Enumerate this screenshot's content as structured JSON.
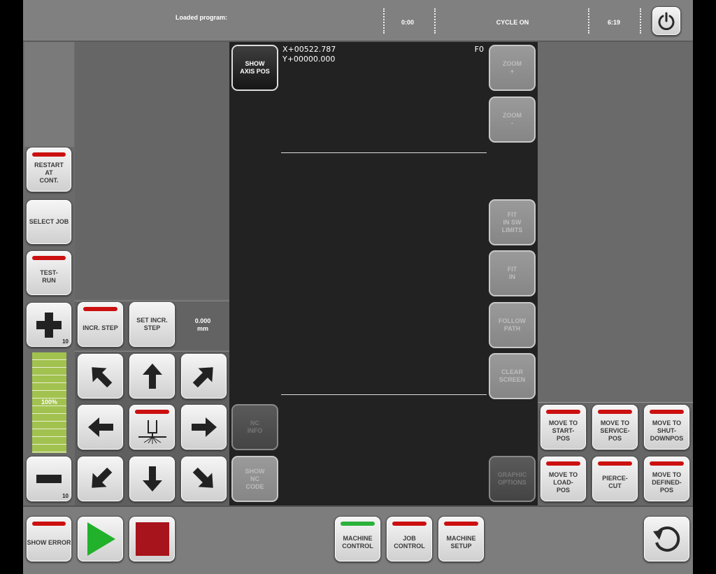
{
  "topbar": {
    "loaded_program_label": "Loaded program:",
    "time1": "0:00",
    "cycle_status": "CYCLE ON",
    "time2": "6:19"
  },
  "left_column": {
    "restart_at_cont": "RESTART\nAT\nCONT.",
    "select_job": "SELECT JOB",
    "test_run": "TEST-\nRUN",
    "plus_sub": "10",
    "minus_sub": "10",
    "override_percent": "100%",
    "override_fill": 1.0
  },
  "incr": {
    "incr_step": "INCR. STEP",
    "set_incr_step": "SET INCR.\nSTEP",
    "step_value": "0.000",
    "step_unit": "mm"
  },
  "graphic": {
    "show_axis_pos": "SHOW\nAXIS POS",
    "x_pos": "X+00522.787",
    "y_pos": "Y+00000.000",
    "feed": "F0",
    "nc_info": "NC\nINFO",
    "show_nc_code": "SHOW\nNC\nCODE",
    "zoom_in": "ZOOM\n+",
    "zoom_out": "ZOOM\n-",
    "fit_sw_limits": "FIT\nIN SW\nLIMITS",
    "fit_in": "FIT\nIN",
    "follow_path": "FOLLOW\nPATH",
    "clear_screen": "CLEAR\nSCREEN",
    "graphic_options": "GRAPHIC\nOPTIONS"
  },
  "move_buttons": {
    "start_pos": "MOVE TO\nSTART-\nPOS",
    "service_pos": "MOVE TO\nSERVICE-\nPOS",
    "shutdown_pos": "MOVE TO\nSHUT-\nDOWNPOS",
    "load_pos": "MOVE TO\nLOAD-\nPOS",
    "pierce_cut": "PIERCE-\nCUT",
    "defined_pos": "MOVE TO\nDEFINED-\nPOS"
  },
  "bottombar": {
    "show_error": "SHOW ERROR",
    "machine_control": "MACHINE\nCONTROL",
    "job_control": "JOB\nCONTROL",
    "machine_setup": "MACHINE\nSETUP"
  },
  "colors": {
    "indicator_red": "#cc1010",
    "indicator_green": "#2bb23a",
    "start_green": "#22b12a",
    "stop_red": "#a8141c"
  }
}
